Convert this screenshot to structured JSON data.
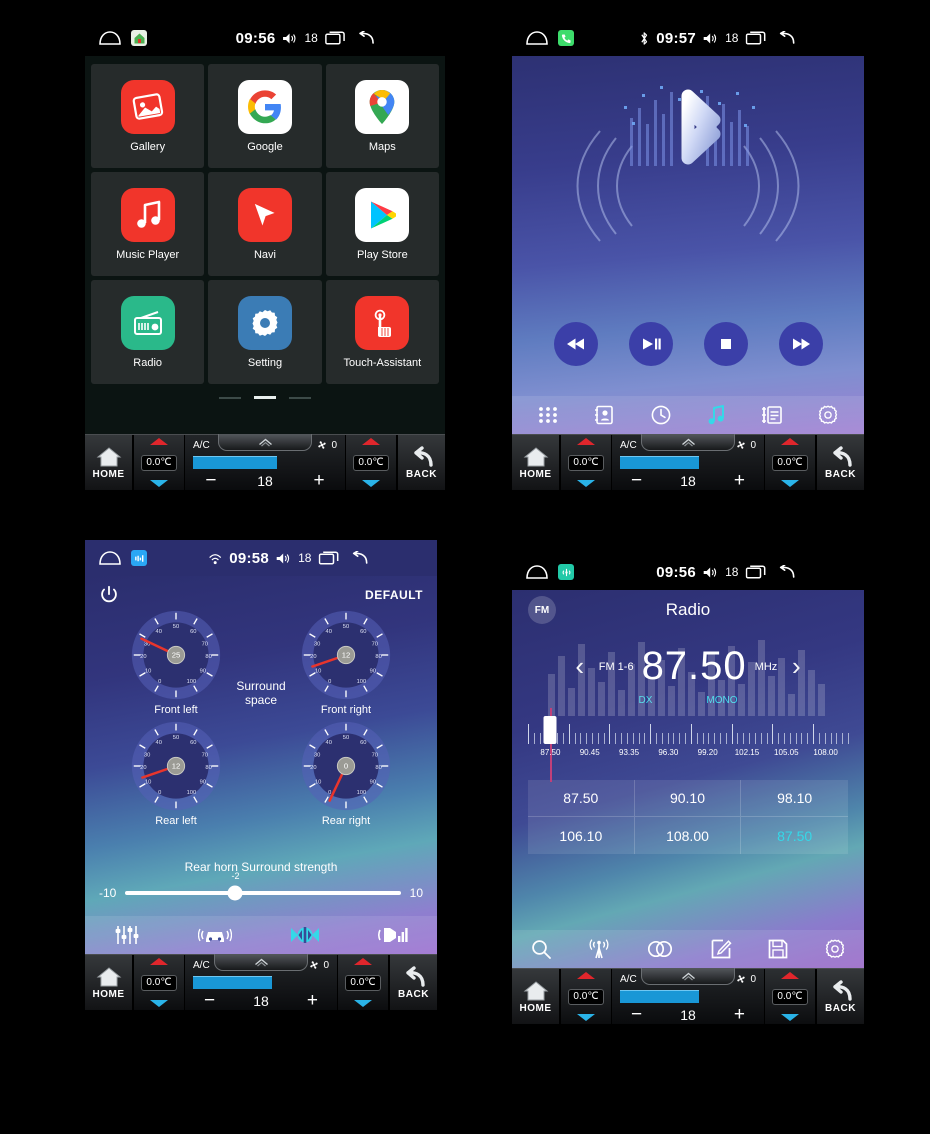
{
  "theme": {
    "page_bg": "#000000",
    "accent_cyan": "#35d8e8",
    "climate_bar_blue": "#1997d6",
    "needle_red": "#e0262c"
  },
  "panels": {
    "launcher": {
      "statusbar": {
        "home_icon": "home-outline-icon",
        "app_badge_icon": "house-app-icon",
        "time": "09:56",
        "volume_icon": "volume-icon",
        "volume": "18",
        "recents_icon": "recents-icon",
        "back_icon": "back-arrow-icon"
      },
      "apps": [
        {
          "label": "Gallery",
          "icon": "gallery-icon",
          "bg": "#f1352b"
        },
        {
          "label": "Google",
          "icon": "google-icon",
          "bg": "#ffffff"
        },
        {
          "label": "Maps",
          "icon": "maps-icon",
          "bg": "#ffffff"
        },
        {
          "label": "Music Player",
          "icon": "music-note-icon",
          "bg": "#f1352b"
        },
        {
          "label": "Navi",
          "icon": "navigation-arrow-icon",
          "bg": "#f1352b"
        },
        {
          "label": "Play Store",
          "icon": "play-store-icon",
          "bg": "#ffffff"
        },
        {
          "label": "Radio",
          "icon": "radio-icon",
          "bg": "#2ab98a"
        },
        {
          "label": "Setting",
          "icon": "gear-icon",
          "bg": "#3b7cb5"
        },
        {
          "label": "Touch-Assistant",
          "icon": "touch-assistant-icon",
          "bg": "#f1352b"
        }
      ],
      "page_dots": {
        "count": 3,
        "active_index": 1
      }
    },
    "bluetooth": {
      "statusbar": {
        "home_icon": "home-outline-icon",
        "app_badge_icon": "phone-app-icon",
        "bluetooth_icon": "bluetooth-icon",
        "time": "09:57",
        "volume_icon": "volume-icon",
        "volume": "18",
        "recents_icon": "recents-icon",
        "back_icon": "back-arrow-icon"
      },
      "artwork_icon": "bluetooth-logo-art",
      "transport": [
        {
          "name": "previous-track-button",
          "icon": "skip-back-icon"
        },
        {
          "name": "play-pause-button",
          "icon": "play-pause-icon"
        },
        {
          "name": "stop-button",
          "icon": "stop-icon"
        },
        {
          "name": "next-track-button",
          "icon": "skip-forward-icon"
        }
      ],
      "nav": [
        {
          "name": "bt-nav-dialpad",
          "icon": "dialpad-icon",
          "active": false
        },
        {
          "name": "bt-nav-contacts",
          "icon": "contacts-icon",
          "active": false
        },
        {
          "name": "bt-nav-history",
          "icon": "clock-icon",
          "active": false
        },
        {
          "name": "bt-nav-music",
          "icon": "music-note-icon",
          "active": true
        },
        {
          "name": "bt-nav-playlist",
          "icon": "playlist-icon",
          "active": false
        },
        {
          "name": "bt-nav-settings",
          "icon": "gear-icon",
          "active": false
        }
      ]
    },
    "equalizer": {
      "statusbar": {
        "home_icon": "home-outline-icon",
        "app_badge_icon": "eq-app-icon",
        "signal_icon": "wifi-signal-icon",
        "time": "09:58",
        "volume_icon": "volume-icon",
        "volume": "18",
        "recents_icon": "recents-icon",
        "back_icon": "back-arrow-icon"
      },
      "power_icon": "power-icon",
      "preset_label": "DEFAULT",
      "center_label_line1": "Surround",
      "center_label_line2": "space",
      "gauges": [
        {
          "label": "Front left",
          "value": 25,
          "min": 0,
          "max": 100
        },
        {
          "label": "Front right",
          "value": 12,
          "min": 0,
          "max": 100
        },
        {
          "label": "Rear left",
          "value": 12,
          "min": 0,
          "max": 100
        },
        {
          "label": "Rear right",
          "value": 0,
          "min": 0,
          "max": 100
        }
      ],
      "slider": {
        "title": "Rear horn Surround strength",
        "min_label": "-10",
        "max_label": "10",
        "value": -2,
        "min": -10,
        "max": 10
      },
      "nav": [
        {
          "name": "eq-tab-equalizer",
          "icon": "sliders-icon",
          "active": false
        },
        {
          "name": "eq-tab-car-surround",
          "icon": "car-surround-icon",
          "active": false
        },
        {
          "name": "eq-tab-balance",
          "icon": "balance-icon",
          "active": true
        },
        {
          "name": "eq-tab-loudness",
          "icon": "loudness-icon",
          "active": false
        }
      ]
    },
    "radio": {
      "statusbar": {
        "home_icon": "home-outline-icon",
        "app_badge_icon": "radio-app-icon",
        "time": "09:56",
        "volume_icon": "volume-icon",
        "volume": "18",
        "recents_icon": "recents-icon",
        "back_icon": "back-arrow-icon"
      },
      "band_badge": "FM",
      "title": "Radio",
      "prev_icon": "chevron-left-icon",
      "next_icon": "chevron-right-icon",
      "band_label": "FM 1-6",
      "frequency": "87.50",
      "unit": "MHz",
      "modes": [
        "DX",
        "MONO"
      ],
      "scale": {
        "labels": [
          "87.50",
          "90.45",
          "93.35",
          "96.30",
          "99.20",
          "102.15",
          "105.05",
          "108.00"
        ],
        "cursor_label": "87.50"
      },
      "presets": [
        {
          "value": "87.50",
          "active": false
        },
        {
          "value": "90.10",
          "active": false
        },
        {
          "value": "98.10",
          "active": false
        },
        {
          "value": "106.10",
          "active": false
        },
        {
          "value": "108.00",
          "active": false
        },
        {
          "value": "87.50",
          "active": true
        }
      ],
      "nav": [
        {
          "name": "radio-search-button",
          "icon": "search-icon"
        },
        {
          "name": "radio-antenna-button",
          "icon": "antenna-icon"
        },
        {
          "name": "radio-stereo-button",
          "icon": "stereo-icon"
        },
        {
          "name": "radio-edit-button",
          "icon": "edit-icon"
        },
        {
          "name": "radio-save-button",
          "icon": "save-icon"
        },
        {
          "name": "radio-settings-button",
          "icon": "gear-icon"
        }
      ]
    }
  },
  "climate": {
    "home_label": "HOME",
    "back_label": "BACK",
    "left_temp": "0.0℃",
    "right_temp": "0.0℃",
    "ac_label": "A/C",
    "fan_icon": "fan-icon",
    "fan_speed": "0",
    "minus_label": "−",
    "plus_label": "+",
    "set_temp": "18"
  }
}
